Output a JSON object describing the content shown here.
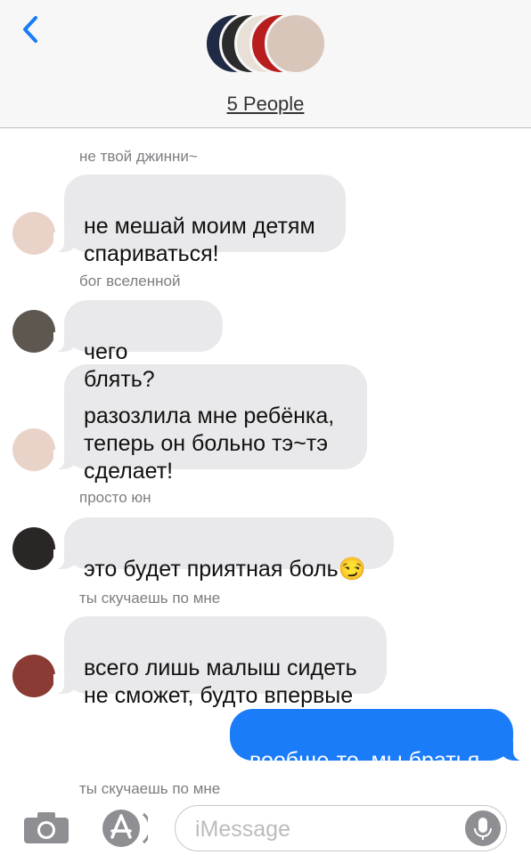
{
  "header": {
    "back_icon": "chevron-left-icon",
    "group_label": "5 People",
    "colors": {
      "accent": "#1a7cf8",
      "bar": "#f7f7f7"
    }
  },
  "messages": [
    {
      "sender": "не твой джинни~",
      "text": "не мешай моим детям\nспариваться!",
      "avatar": "avatar-1"
    },
    {
      "sender": "бог вселенной",
      "text": "чего блять?",
      "avatar": "avatar-2"
    },
    {
      "sender": "",
      "text": "разозлила мне ребёнка,\nтеперь он больно тэ~тэ\nсделает!",
      "avatar": "avatar-1"
    },
    {
      "sender": "просто юн",
      "text": "это будет приятная боль😏",
      "avatar": "avatar-3"
    },
    {
      "sender": "ты скучаешь по мне",
      "text": "всего лишь малыш сидеть\nне сможет, будто впервые",
      "avatar": "avatar-4"
    },
    {
      "sender": "",
      "text": "вообще-то, мы братья.",
      "outgoing": true
    }
  ],
  "typing_sender": "ты скучаешь по мне",
  "input": {
    "placeholder": "iMessage",
    "camera_icon": "camera-icon",
    "apps_icon": "app-store-icon",
    "mic_icon": "microphone-icon"
  }
}
